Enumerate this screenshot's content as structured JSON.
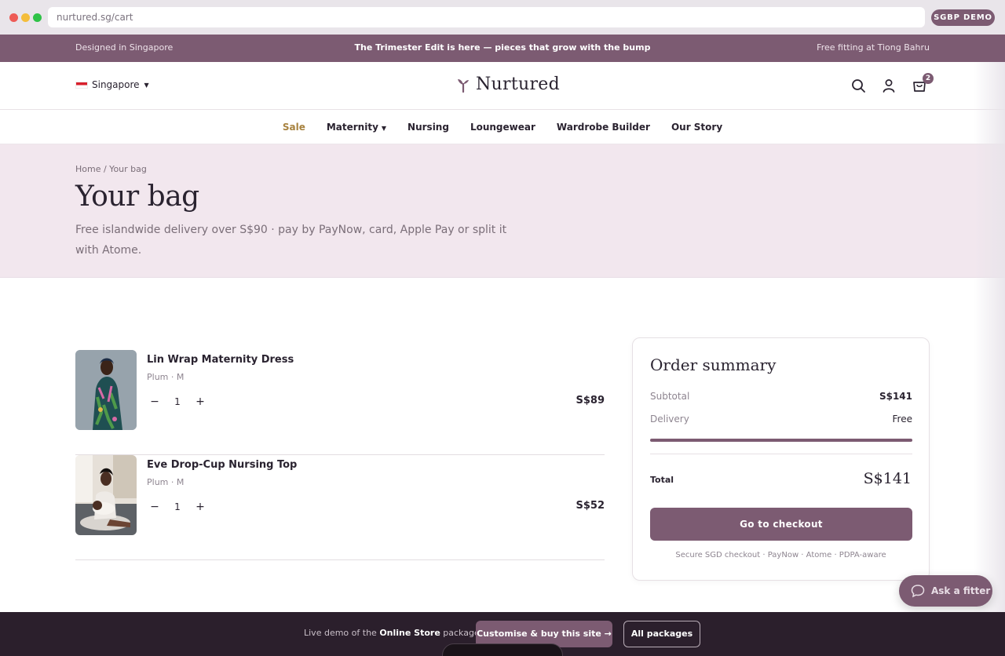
{
  "browser": {
    "url": "nurtured.sg/cart",
    "badge": "SGBP DEMO"
  },
  "announcement": {
    "left": "Designed in Singapore",
    "center": "The Trimester Edit is here — pieces that grow with the bump",
    "right": "Free fitting at Tiong Bahru"
  },
  "header": {
    "locale": "Singapore",
    "brand": "Nurtured",
    "bag_count": "2"
  },
  "nav": {
    "items": [
      "Sale",
      "Maternity",
      "Nursing",
      "Loungewear",
      "Wardrobe Builder",
      "Our Story"
    ]
  },
  "hero": {
    "breadcrumb": "Home / Your bag",
    "title": "Your bag",
    "subtitle": "Free islandwide delivery over S$90 · pay by PayNow, card, Apple Pay or split it with Atome."
  },
  "cart": {
    "items": [
      {
        "name": "Lin Wrap Maternity Dress",
        "variant": "Plum · M",
        "qty": "1",
        "price": "S$89"
      },
      {
        "name": "Eve Drop-Cup Nursing Top",
        "variant": "Plum · M",
        "qty": "1",
        "price": "S$52"
      }
    ]
  },
  "summary": {
    "title": "Order summary",
    "subtotal_label": "Subtotal",
    "subtotal_value": "S$141",
    "delivery_label": "Delivery",
    "delivery_value": "Free",
    "delivery_progress": 1.0,
    "total_label": "Total",
    "total_value": "S$141",
    "checkout_label": "Go to checkout",
    "secure_note": "Secure SGD checkout · PayNow · Atome · PDPA-aware"
  },
  "fitter": {
    "label": "Ask a fitter"
  },
  "demo_bar": {
    "text_prefix": "Live demo of the",
    "text_bold": "Online Store",
    "text_suffix": "package.",
    "buy_label": "Customise & buy this site →",
    "packages_label": "All packages"
  },
  "colors": {
    "brand": "#7c5b72",
    "hero_bg": "#f2e7ee",
    "sale": "#a7823f",
    "footer_bg": "#2b1f2c"
  }
}
